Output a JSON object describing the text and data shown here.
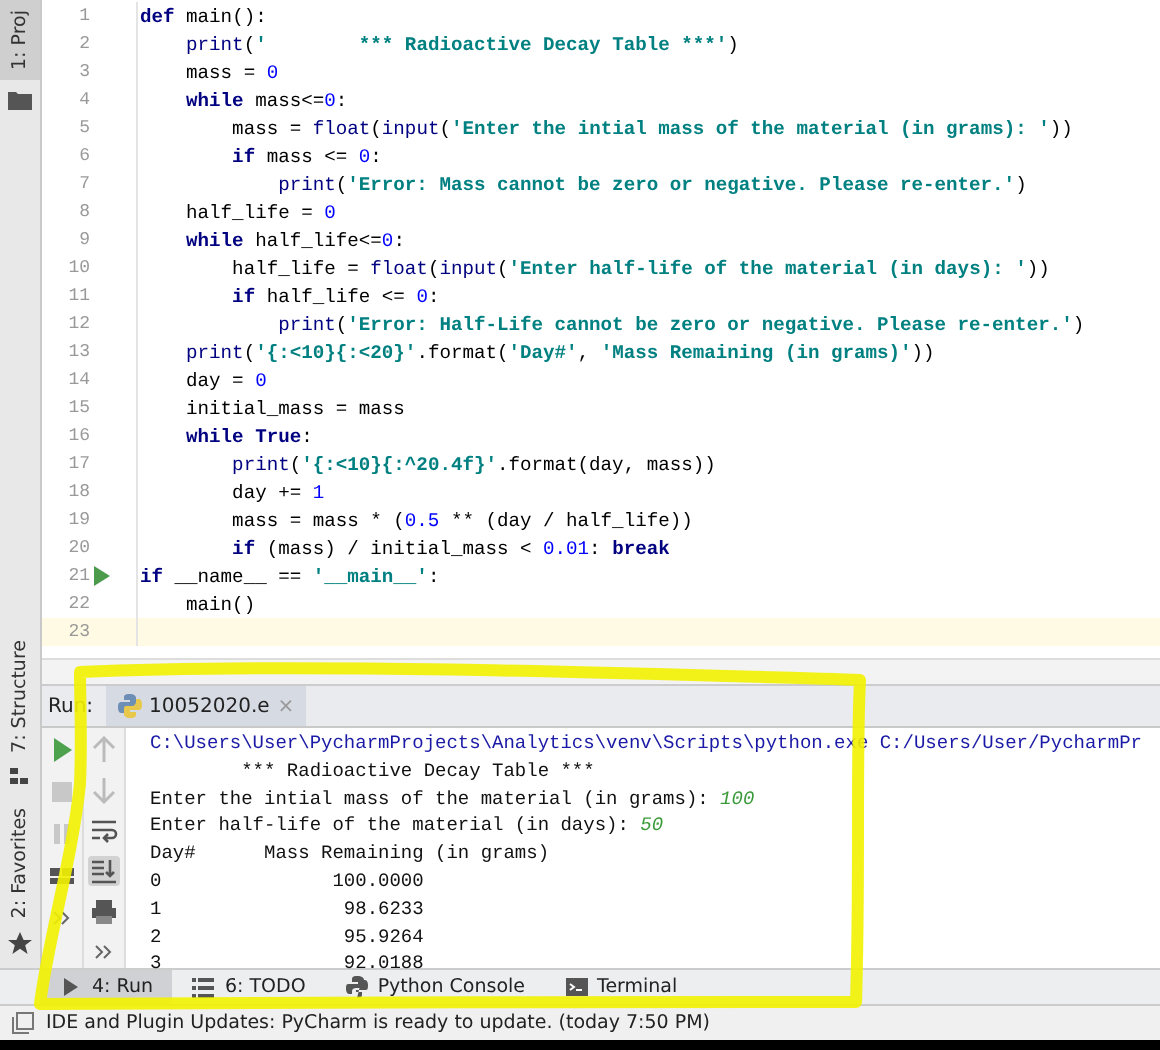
{
  "left_stripe": {
    "top": [
      {
        "label": "1: Proj",
        "selected": true
      }
    ],
    "bottom": [
      {
        "label": "7: Structure",
        "kind": "structure"
      },
      {
        "label": "2: Favorites",
        "kind": "favorites"
      }
    ]
  },
  "editor": {
    "lines": [
      {
        "number": "1",
        "run": false,
        "current": false,
        "tokens": [
          {
            "kind": "kw",
            "t": "def"
          },
          {
            "kind": "p",
            "t": " main():"
          }
        ]
      },
      {
        "number": "2",
        "run": false,
        "current": false,
        "tokens": [
          {
            "kind": "bi",
            "t": "    print"
          },
          {
            "kind": "p",
            "t": "("
          },
          {
            "kind": "str",
            "t": "'        *** Radioactive Decay Table ***'"
          },
          {
            "kind": "p",
            "t": ")"
          }
        ]
      },
      {
        "number": "3",
        "run": false,
        "current": false,
        "tokens": [
          {
            "kind": "p",
            "t": "    mass = "
          },
          {
            "kind": "num",
            "t": "0"
          }
        ]
      },
      {
        "number": "4",
        "run": false,
        "current": false,
        "tokens": [
          {
            "kind": "kw",
            "t": "    while"
          },
          {
            "kind": "p",
            "t": " mass<="
          },
          {
            "kind": "num",
            "t": "0"
          },
          {
            "kind": "p",
            "t": ":"
          }
        ]
      },
      {
        "number": "5",
        "run": false,
        "current": false,
        "tokens": [
          {
            "kind": "p",
            "t": "        mass = "
          },
          {
            "kind": "bi",
            "t": "float"
          },
          {
            "kind": "p",
            "t": "("
          },
          {
            "kind": "bi",
            "t": "input"
          },
          {
            "kind": "p",
            "t": "("
          },
          {
            "kind": "str",
            "t": "'Enter the intial mass of the material (in grams): '"
          },
          {
            "kind": "p",
            "t": "))"
          }
        ]
      },
      {
        "number": "6",
        "run": false,
        "current": false,
        "tokens": [
          {
            "kind": "kw",
            "t": "        if"
          },
          {
            "kind": "p",
            "t": " mass <= "
          },
          {
            "kind": "num",
            "t": "0"
          },
          {
            "kind": "p",
            "t": ":"
          }
        ]
      },
      {
        "number": "7",
        "run": false,
        "current": false,
        "tokens": [
          {
            "kind": "bi",
            "t": "            print"
          },
          {
            "kind": "p",
            "t": "("
          },
          {
            "kind": "str",
            "t": "'Error: Mass cannot be zero or negative. Please re-enter.'"
          },
          {
            "kind": "p",
            "t": ")"
          }
        ]
      },
      {
        "number": "8",
        "run": false,
        "current": false,
        "tokens": [
          {
            "kind": "p",
            "t": "    half_life = "
          },
          {
            "kind": "num",
            "t": "0"
          }
        ]
      },
      {
        "number": "9",
        "run": false,
        "current": false,
        "tokens": [
          {
            "kind": "kw",
            "t": "    while"
          },
          {
            "kind": "p",
            "t": " half_life<="
          },
          {
            "kind": "num",
            "t": "0"
          },
          {
            "kind": "p",
            "t": ":"
          }
        ]
      },
      {
        "number": "10",
        "run": false,
        "current": false,
        "tokens": [
          {
            "kind": "p",
            "t": "        half_life = "
          },
          {
            "kind": "bi",
            "t": "float"
          },
          {
            "kind": "p",
            "t": "("
          },
          {
            "kind": "bi",
            "t": "input"
          },
          {
            "kind": "p",
            "t": "("
          },
          {
            "kind": "str",
            "t": "'Enter half-life of the material (in days): '"
          },
          {
            "kind": "p",
            "t": "))"
          }
        ]
      },
      {
        "number": "11",
        "run": false,
        "current": false,
        "tokens": [
          {
            "kind": "kw",
            "t": "        if"
          },
          {
            "kind": "p",
            "t": " half_life <= "
          },
          {
            "kind": "num",
            "t": "0"
          },
          {
            "kind": "p",
            "t": ":"
          }
        ]
      },
      {
        "number": "12",
        "run": false,
        "current": false,
        "tokens": [
          {
            "kind": "bi",
            "t": "            print"
          },
          {
            "kind": "p",
            "t": "("
          },
          {
            "kind": "str",
            "t": "'Error: Half-Life cannot be zero or negative. Please re-enter.'"
          },
          {
            "kind": "p",
            "t": ")"
          }
        ]
      },
      {
        "number": "13",
        "run": false,
        "current": false,
        "tokens": [
          {
            "kind": "bi",
            "t": "    print"
          },
          {
            "kind": "p",
            "t": "("
          },
          {
            "kind": "str",
            "t": "'{:<10}{:<20}'"
          },
          {
            "kind": "p",
            "t": ".format("
          },
          {
            "kind": "str",
            "t": "'Day#'"
          },
          {
            "kind": "p",
            "t": ", "
          },
          {
            "kind": "str",
            "t": "'Mass Remaining (in grams)'"
          },
          {
            "kind": "p",
            "t": "))"
          }
        ]
      },
      {
        "number": "14",
        "run": false,
        "current": false,
        "tokens": [
          {
            "kind": "p",
            "t": "    day = "
          },
          {
            "kind": "num",
            "t": "0"
          }
        ]
      },
      {
        "number": "15",
        "run": false,
        "current": false,
        "tokens": [
          {
            "kind": "p",
            "t": "    initial_mass = mass"
          }
        ]
      },
      {
        "number": "16",
        "run": false,
        "current": false,
        "tokens": [
          {
            "kind": "kw",
            "t": "    while True"
          },
          {
            "kind": "p",
            "t": ":"
          }
        ]
      },
      {
        "number": "17",
        "run": false,
        "current": false,
        "tokens": [
          {
            "kind": "bi",
            "t": "        print"
          },
          {
            "kind": "p",
            "t": "("
          },
          {
            "kind": "str",
            "t": "'{:<10}{:^20.4f}'"
          },
          {
            "kind": "p",
            "t": ".format(day, mass))"
          }
        ]
      },
      {
        "number": "18",
        "run": false,
        "current": false,
        "tokens": [
          {
            "kind": "p",
            "t": "        day += "
          },
          {
            "kind": "num",
            "t": "1"
          }
        ]
      },
      {
        "number": "19",
        "run": false,
        "current": false,
        "tokens": [
          {
            "kind": "p",
            "t": "        mass = mass * ("
          },
          {
            "kind": "num",
            "t": "0.5"
          },
          {
            "kind": "p",
            "t": " ** (day / half_life))"
          }
        ]
      },
      {
        "number": "20",
        "run": false,
        "current": false,
        "tokens": [
          {
            "kind": "kw",
            "t": "        if"
          },
          {
            "kind": "p",
            "t": " (mass) / initial_mass < "
          },
          {
            "kind": "num",
            "t": "0.01"
          },
          {
            "kind": "p",
            "t": ": "
          },
          {
            "kind": "kw",
            "t": "break"
          }
        ]
      },
      {
        "number": "21",
        "run": true,
        "current": false,
        "tokens": [
          {
            "kind": "kw",
            "t": "if"
          },
          {
            "kind": "p",
            "t": " __name__ == "
          },
          {
            "kind": "str",
            "t": "'__main__'"
          },
          {
            "kind": "p",
            "t": ":"
          }
        ]
      },
      {
        "number": "22",
        "run": false,
        "current": false,
        "tokens": [
          {
            "kind": "p",
            "t": "    main()"
          }
        ]
      },
      {
        "number": "23",
        "run": false,
        "current": true
      }
    ]
  },
  "run_panel": {
    "label": "Run:",
    "tab": {
      "title": "10052020.e",
      "close": "×"
    },
    "toolbar_1": [
      {
        "kind": "run",
        "selected": false
      },
      {
        "kind": "stop",
        "selected": false
      },
      {
        "kind": "pause",
        "selected": false
      },
      {
        "kind": "layout",
        "selected": false
      },
      {
        "kind": "more",
        "selected": false
      }
    ],
    "toolbar_2": [
      {
        "kind": "up",
        "selected": false
      },
      {
        "kind": "down",
        "selected": false
      },
      {
        "kind": "wrap",
        "selected": false
      },
      {
        "kind": "scroll-end",
        "selected": true
      },
      {
        "kind": "print",
        "selected": false
      },
      {
        "kind": "more",
        "selected": false
      }
    ],
    "console": [
      {
        "kind": "command",
        "text": "C:\\Users\\User\\PycharmProjects\\Analytics\\venv\\Scripts\\python.exe C:/Users/User/PycharmPr"
      },
      {
        "kind": "output",
        "text": "        *** Radioactive Decay Table ***"
      },
      {
        "kind": "prompt",
        "text": "Enter the intial mass of the material (in grams): ",
        "input": "100"
      },
      {
        "kind": "prompt",
        "text": "Enter half-life of the material (in days): ",
        "input": "50"
      },
      {
        "kind": "output",
        "text": "Day#      Mass Remaining (in grams)"
      },
      {
        "kind": "output",
        "text": "0               100.0000"
      },
      {
        "kind": "output",
        "text": "1                98.6233"
      },
      {
        "kind": "output",
        "text": "2                95.9264"
      },
      {
        "kind": "output",
        "text": "3                92.0188"
      }
    ]
  },
  "tool_windows": [
    {
      "label": "4: Run",
      "kind": "run",
      "selected": true
    },
    {
      "label": "6: TODO",
      "kind": "todo",
      "selected": false
    },
    {
      "label": "Python Console",
      "kind": "python",
      "selected": false
    },
    {
      "label": "Terminal",
      "kind": "terminal",
      "selected": false
    }
  ],
  "status_bar": {
    "text": "IDE and Plugin Updates: PyCharm is ready to update. (today 7:50 PM)"
  }
}
